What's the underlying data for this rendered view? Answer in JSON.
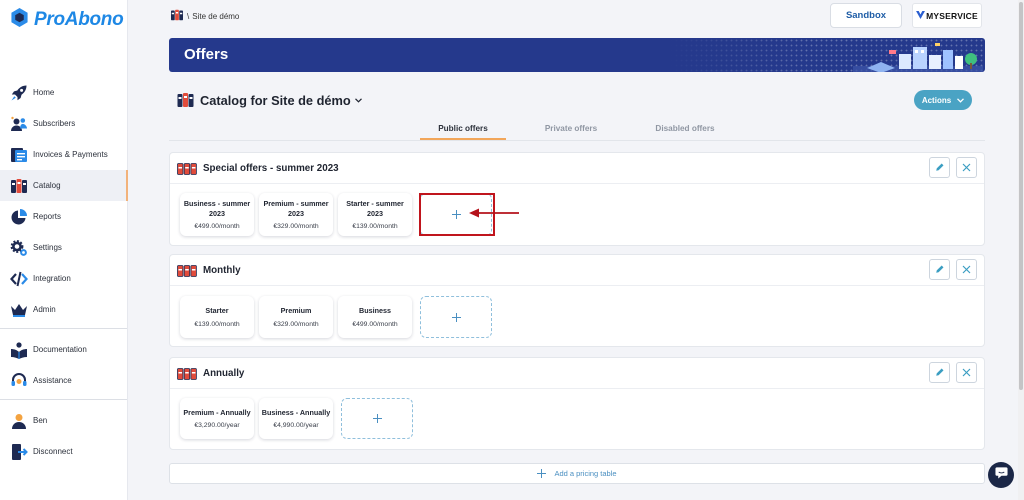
{
  "app": {
    "name": "ProAbono"
  },
  "sidebar": {
    "main": [
      {
        "label": "Home",
        "icon": "rocket-icon"
      },
      {
        "label": "Subscribers",
        "icon": "users-icon"
      },
      {
        "label": "Invoices & Payments",
        "icon": "invoices-icon"
      },
      {
        "label": "Catalog",
        "icon": "catalog-icon",
        "active": true
      },
      {
        "label": "Reports",
        "icon": "pie-chart-icon"
      },
      {
        "label": "Settings",
        "icon": "gear-icon"
      },
      {
        "label": "Integration",
        "icon": "code-icon"
      },
      {
        "label": "Admin",
        "icon": "crown-icon"
      }
    ],
    "help": [
      {
        "label": "Documentation",
        "icon": "book-reader-icon"
      },
      {
        "label": "Assistance",
        "icon": "headset-icon"
      }
    ],
    "account": [
      {
        "label": "Ben",
        "icon": "user-icon"
      },
      {
        "label": "Disconnect",
        "icon": "logout-icon"
      }
    ]
  },
  "topbar": {
    "breadcrumb": {
      "separator": "\\",
      "current": "Site de démo"
    },
    "sandbox_label": "Sandbox",
    "brand_label": "MYSERVICE"
  },
  "banner": {
    "title": "Offers"
  },
  "catalog": {
    "title": "Catalog for Site de démo",
    "actions_label": "Actions"
  },
  "tabs": [
    {
      "label": "Public offers",
      "active": true
    },
    {
      "label": "Private offers",
      "active": false
    },
    {
      "label": "Disabled offers",
      "active": false
    }
  ],
  "sections": [
    {
      "title": "Special offers - summer 2023",
      "offers": [
        {
          "name": "Business - summer 2023",
          "price": "€499.00/month"
        },
        {
          "name": "Premium - summer 2023",
          "price": "€329.00/month"
        },
        {
          "name": "Starter - summer 2023",
          "price": "€139.00/month"
        }
      ]
    },
    {
      "title": "Monthly",
      "offers": [
        {
          "name": "Starter",
          "price": "€139.00/month"
        },
        {
          "name": "Premium",
          "price": "€329.00/month"
        },
        {
          "name": "Business",
          "price": "€499.00/month"
        }
      ]
    },
    {
      "title": "Annually",
      "offers": [
        {
          "name": "Premium - Annually",
          "price": "€3,290.00/year"
        },
        {
          "name": "Business - Annually",
          "price": "€4,990.00/year"
        }
      ]
    }
  ],
  "footer": {
    "add_pricing_table_label": "Add a pricing table"
  },
  "colors": {
    "brand": "#1e88e5",
    "banner": "#25398c",
    "accent": "#4aa3c4",
    "tab_underline": "#f2a65a",
    "active_marker": "#f2b27a",
    "annotation": "#c0151d",
    "nav_icon": "#1e2a52",
    "icon_blue": "#2b8be8",
    "icon_orange": "#f4a340",
    "icon_red": "#e14b3b",
    "link": "#4a8fc1",
    "sandbox_text": "#1f5da6",
    "chat": "#1b2747"
  }
}
